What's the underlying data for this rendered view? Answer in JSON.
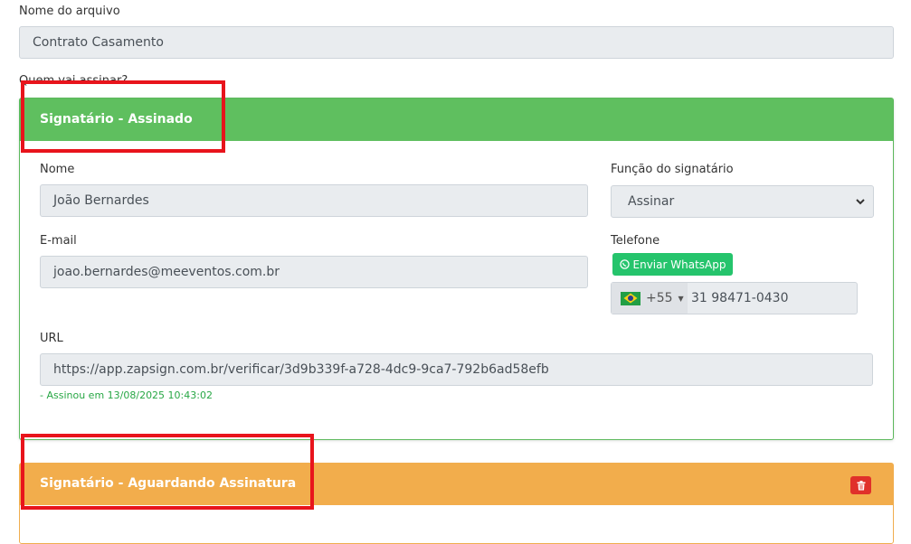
{
  "file_name_label": "Nome do arquivo",
  "file_name_value": "Contrato Casamento",
  "who_signs_label": "Quem vai assinar?",
  "signer1": {
    "header": "Signatário - Assinado",
    "header_color": "#5fbf5f",
    "name_label": "Nome",
    "name_value": "João Bernardes",
    "role_label": "Função do signatário",
    "role_value": "Assinar",
    "email_label": "E-mail",
    "email_value": "joao.bernardes@meeventos.com.br",
    "phone_label": "Telefone",
    "whatsapp_button": "Enviar WhatsApp",
    "country_code": "+55",
    "phone_value": "31 98471-0430",
    "url_label": "URL",
    "url_value": "https://app.zapsign.com.br/verificar/3d9b339f-a728-4dc9-9ca7-792b6ad58efb",
    "signed_note": "- Assinou em 13/08/2025 10:43:02"
  },
  "signer2": {
    "header": "Signatário - Aguardando Assinatura",
    "header_color": "#f2ad4c"
  },
  "icons": {
    "whatsapp": "whatsapp-icon",
    "flag": "brazil-flag-icon",
    "trash": "trash-icon",
    "chevron": "chevron-down-icon"
  }
}
